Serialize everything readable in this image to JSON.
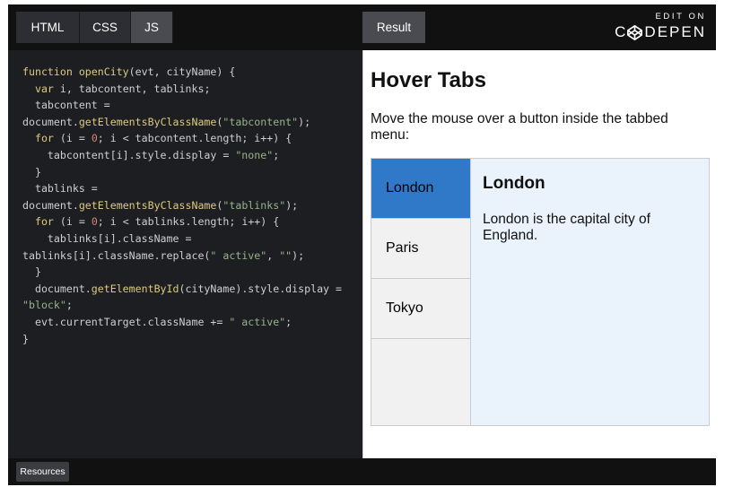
{
  "editor": {
    "tabs": [
      {
        "label": "HTML",
        "active": false
      },
      {
        "label": "CSS",
        "active": false
      },
      {
        "label": "JS",
        "active": true
      }
    ],
    "result_label": "Result",
    "brand": {
      "edit_on": "EDIT ON",
      "name_rest": "DEPEN"
    },
    "resources_label": "Resources"
  },
  "result": {
    "title": "Hover Tabs",
    "description": "Move the mouse over a button inside the tabbed menu:",
    "tabs": [
      {
        "label": "London",
        "active": true
      },
      {
        "label": "Paris",
        "active": false
      },
      {
        "label": "Tokyo",
        "active": false
      }
    ],
    "content": {
      "title": "London",
      "body": "London is the capital city of England."
    }
  },
  "code": {
    "lines": [
      [
        [
          "fn",
          "function openCity"
        ],
        [
          "t",
          "(evt, cityName) {"
        ]
      ],
      [
        [
          "t",
          "  "
        ],
        [
          "kw",
          "var"
        ],
        [
          "t",
          " i, tabcontent, tablinks;"
        ]
      ],
      [
        [
          "t",
          "  tabcontent ="
        ]
      ],
      [
        [
          "t",
          "document."
        ],
        [
          "fn",
          "getElementsByClassName"
        ],
        [
          "t",
          "("
        ],
        [
          "str",
          "\"tabcontent\""
        ],
        [
          "t",
          ");"
        ]
      ],
      [
        [
          "t",
          "  "
        ],
        [
          "kw",
          "for"
        ],
        [
          "t",
          " (i = "
        ],
        [
          "num",
          "0"
        ],
        [
          "t",
          "; i < tabcontent.length; i++) {"
        ]
      ],
      [
        [
          "t",
          "    tabcontent[i].style.display = "
        ],
        [
          "str",
          "\"none\""
        ],
        [
          "t",
          ";"
        ]
      ],
      [
        [
          "t",
          "  }"
        ]
      ],
      [
        [
          "t",
          "  tablinks ="
        ]
      ],
      [
        [
          "t",
          "document."
        ],
        [
          "fn",
          "getElementsByClassName"
        ],
        [
          "t",
          "("
        ],
        [
          "str",
          "\"tablinks\""
        ],
        [
          "t",
          ");"
        ]
      ],
      [
        [
          "t",
          "  "
        ],
        [
          "kw",
          "for"
        ],
        [
          "t",
          " (i = "
        ],
        [
          "num",
          "0"
        ],
        [
          "t",
          "; i < tablinks.length; i++) {"
        ]
      ],
      [
        [
          "t",
          "    tablinks[i].className ="
        ]
      ],
      [
        [
          "t",
          "tablinks[i].className.replace("
        ],
        [
          "str",
          "\" active\""
        ],
        [
          "t",
          ", "
        ],
        [
          "str",
          "\"\""
        ],
        [
          "t",
          ");"
        ]
      ],
      [
        [
          "t",
          "  }"
        ]
      ],
      [
        [
          "t",
          "  document."
        ],
        [
          "fn",
          "getElementById"
        ],
        [
          "t",
          "(cityName).style.display ="
        ]
      ],
      [
        [
          "str",
          "\"block\""
        ],
        [
          "t",
          ";"
        ]
      ],
      [
        [
          "t",
          "  evt.currentTarget.className += "
        ],
        [
          "str",
          "\" active\""
        ],
        [
          "t",
          ";"
        ]
      ],
      [
        [
          "t",
          "}"
        ]
      ]
    ]
  }
}
